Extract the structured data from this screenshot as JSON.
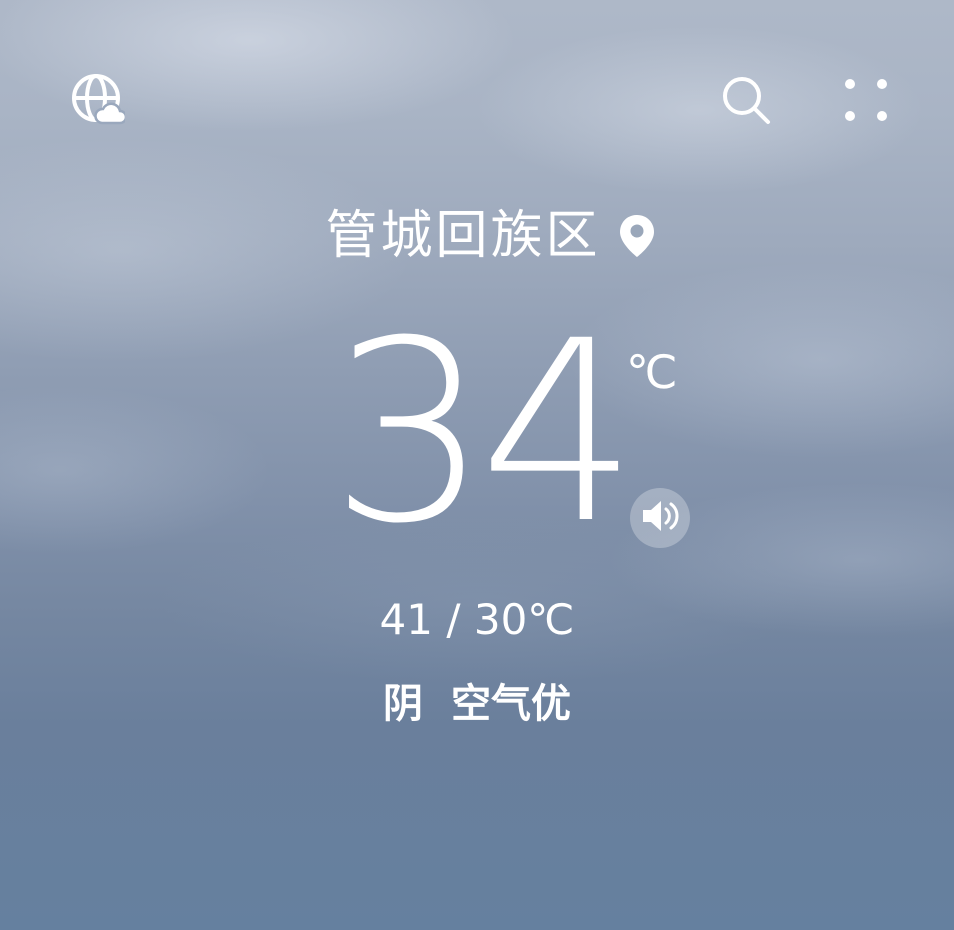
{
  "header": {
    "world_icon": "globe-cloud-icon",
    "search_icon": "search-icon",
    "more_icon": "grid-dots-icon"
  },
  "location": {
    "name": "管城回族区",
    "pin_icon": "location-pin-icon"
  },
  "current": {
    "temperature": "34",
    "unit": "℃",
    "speaker_icon": "speaker-icon"
  },
  "range": "41 / 30℃",
  "condition": {
    "weather": "阴",
    "air_quality": "空气优"
  },
  "colors": {
    "sky_top": "#aeb8c8",
    "sky_bottom": "#65809f",
    "text": "#ffffff"
  }
}
